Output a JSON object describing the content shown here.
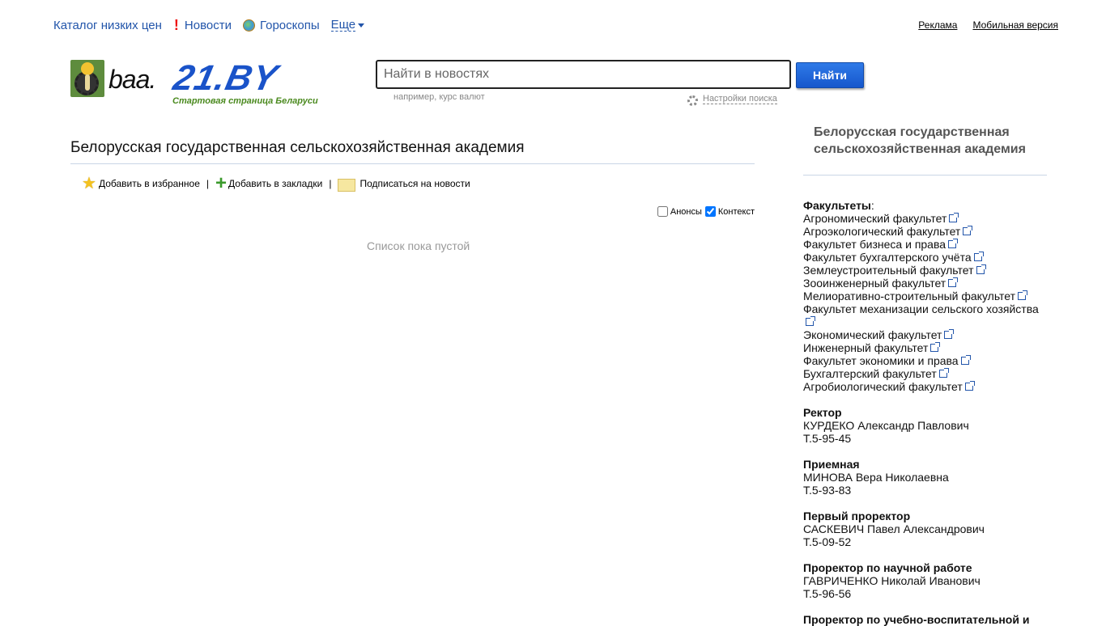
{
  "topnav": {
    "catalog": "Каталог низких цен",
    "news": "Новости",
    "horoscopes": "Гороскопы",
    "more": "Еще"
  },
  "toplinks": {
    "ads": "Реклама",
    "mobile": "Мобильная версия"
  },
  "logo": {
    "prefix": "baa.",
    "brand": "21.BY",
    "slogan": "Стартовая страница Беларуси"
  },
  "search": {
    "placeholder": "Найти в новостях",
    "button": "Найти",
    "hint": "например, курс валют",
    "settings": "Настройки поиска"
  },
  "main": {
    "title": "Белорусская государственная сельскохозяйственная академия",
    "actions": {
      "favorite": "Добавить в избранное",
      "bookmark": "Добавить в закладки",
      "subscribe": "Подписаться на новости",
      "separator": "|"
    },
    "filters": {
      "announcements": "Анонсы",
      "announcements_checked": false,
      "context": "Контекст",
      "context_checked": true
    },
    "empty": "Список пока пустой"
  },
  "sidebar": {
    "title": "Белорусская государственная сельскохозяйственная академия",
    "faculties_label": "Факультеты",
    "faculties": [
      "Агрономический факультет",
      "Агроэкологический факультет",
      "Факультет бизнеса и права",
      "Факультет бухгалтерского учёта",
      "Землеустроительный факультет",
      "Зооинженерный факультет",
      "Мелиоративно-строительный факультет",
      "Факультет механизации сельского хозяйства",
      "Экономический факультет",
      "Инженерный факультет",
      "Факультет экономики и права",
      "Бухгалтерский факультет",
      "Агробиологический факультет"
    ],
    "contacts": [
      {
        "role": "Ректор",
        "name": "КУРДЕКО Александр Павлович",
        "phone": "Т.5-95-45"
      },
      {
        "role": "Приемная",
        "name": "МИНОВА Вера Николаевна",
        "phone": "Т.5-93-83"
      },
      {
        "role": "Первый проректор",
        "name": "САСКЕВИЧ Павел Александрович",
        "phone": "Т.5-09-52"
      },
      {
        "role": "Проректор по научной работе",
        "name": "ГАВРИЧЕНКО Николай Иванович",
        "phone": "Т.5-96-56"
      },
      {
        "role": "Проректор по учебно-воспитательной и",
        "name": "",
        "phone": ""
      }
    ]
  }
}
